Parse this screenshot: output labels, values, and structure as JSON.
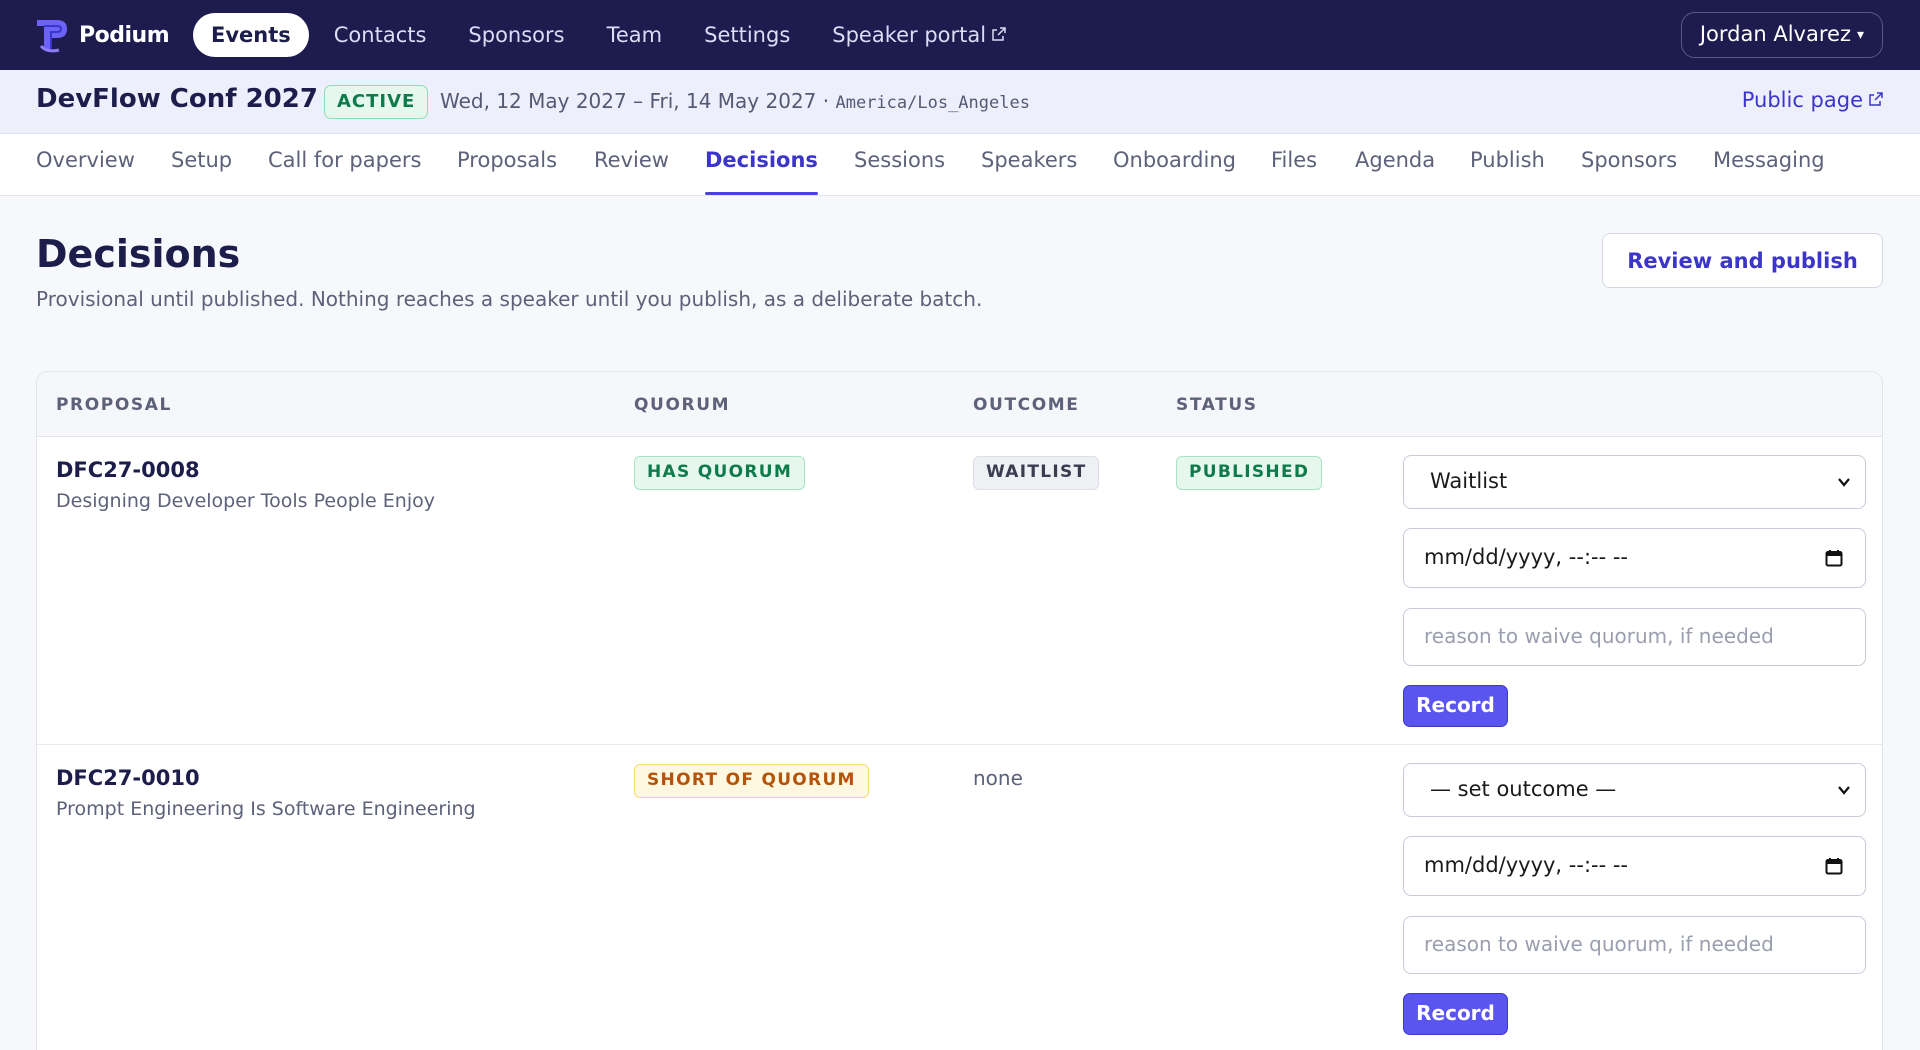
{
  "app": {
    "name": "Podium",
    "nav": [
      "Events",
      "Contacts",
      "Sponsors",
      "Team",
      "Settings",
      "Speaker portal"
    ],
    "active_nav": "Events",
    "user": "Jordan Alvarez"
  },
  "event": {
    "name": "DevFlow Conf 2027",
    "status": "ACTIVE",
    "dates": "Wed, 12 May 2027 – Fri, 14 May 2027 ·",
    "timezone": "America/Los_Angeles",
    "public_link": "Public page"
  },
  "tabs": [
    "Overview",
    "Setup",
    "Call for papers",
    "Proposals",
    "Review",
    "Decisions",
    "Sessions",
    "Speakers",
    "Onboarding",
    "Files",
    "Agenda",
    "Publish",
    "Sponsors",
    "Messaging"
  ],
  "active_tab": "Decisions",
  "page": {
    "title": "Decisions",
    "description": "Provisional until published. Nothing reaches a speaker until you publish, as a deliberate batch.",
    "review_button": "Review and publish"
  },
  "table": {
    "headers": [
      "PROPOSAL",
      "QUORUM",
      "OUTCOME",
      "STATUS"
    ],
    "rows": [
      {
        "id": "DFC27-0008",
        "title": "Designing Developer Tools People Enjoy",
        "quorum": "HAS QUORUM",
        "outcome": "WAITLIST",
        "status": "PUBLISHED",
        "select_value": "Waitlist",
        "date_placeholder": "mm/dd/yyyy, --:-- --",
        "waive_placeholder": "reason to waive quorum, if needed",
        "record_label": "Record"
      },
      {
        "id": "DFC27-0010",
        "title": "Prompt Engineering Is Software Engineering",
        "quorum": "SHORT OF QUORUM",
        "outcome": "none",
        "status": "",
        "select_value": "— set outcome —",
        "date_placeholder": "mm/dd/yyyy, --:-- --",
        "waive_placeholder": "reason to waive quorum, if needed",
        "record_label": "Record"
      }
    ]
  },
  "colors": {
    "nav_bg": "#1e1b4f",
    "accent": "#3b35c9",
    "record_button": "#5b55ef",
    "success": "#0f7a4a",
    "warning": "#b4530a"
  }
}
